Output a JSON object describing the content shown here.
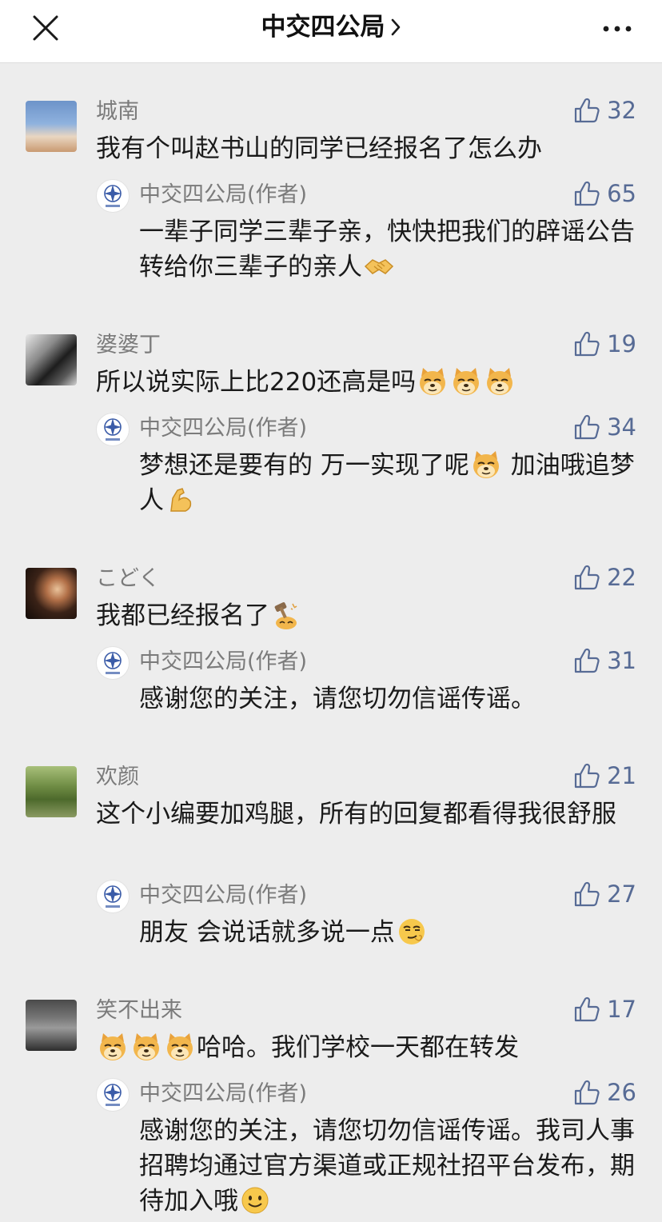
{
  "header": {
    "title": "中交四公局"
  },
  "comments": [
    {
      "name": "城南",
      "likes": "32",
      "text": "我有个叫赵书山的同学已经报名了怎么办",
      "reply": {
        "name": "中交四公局(作者)",
        "likes": "65",
        "text_1": "一辈子同学三辈子亲，快快把我们的辟谣公告转给你三辈子的亲人",
        "emoji": "handshake-emoji"
      }
    },
    {
      "name": "婆婆丁",
      "likes": "19",
      "text": "所以说实际上比220还高是吗",
      "emoji": "doge-emoji",
      "reply": {
        "name": "中交四公局(作者)",
        "likes": "34",
        "text_1": "梦想还是要有的 万一实现了呢",
        "text_2": " 加油哦追梦人",
        "emoji": "muscle-emoji"
      }
    },
    {
      "name": "こどく",
      "likes": "22",
      "text": "我都已经报名了",
      "emoji": "hammer-emoji",
      "reply": {
        "name": "中交四公局(作者)",
        "likes": "31",
        "text_1": "感谢您的关注，请您切勿信谣传谣。"
      }
    },
    {
      "name": "欢颜",
      "likes": "21",
      "text": "这个小编要加鸡腿，所有的回复都看得我很舒服",
      "reply": {
        "name": "中交四公局(作者)",
        "likes": "27",
        "text_1": "朋友 会说话就多说一点",
        "emoji": "smirk-emoji"
      }
    },
    {
      "name": "笑不出来",
      "likes": "17",
      "text": "哈哈。我们学校一天都在转发",
      "emoji": "doge-emoji",
      "reply": {
        "name": "中交四公局(作者)",
        "likes": "26",
        "text_1": "感谢您的关注，请您切勿信谣传谣。我司人事招聘均通过官方渠道或正规社招平台发布，期待加入哦",
        "emoji": "smile-emoji"
      }
    }
  ],
  "colors": {
    "link_blue": "#576b95",
    "name_gray": "#7b7b7b",
    "background": "#ededed"
  }
}
